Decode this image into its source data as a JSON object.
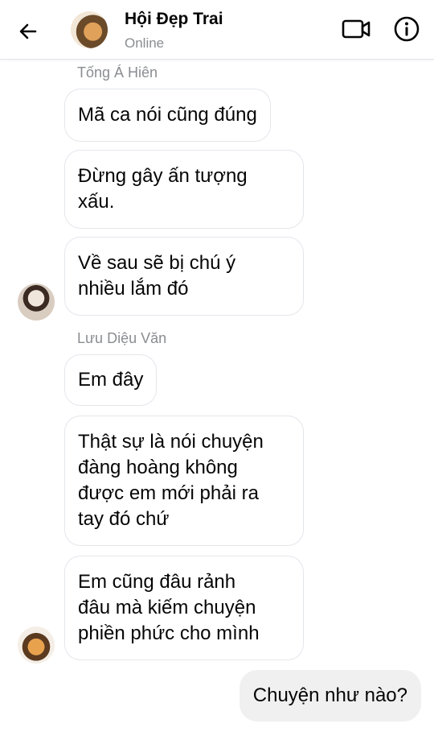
{
  "header": {
    "title": "Hội Đẹp Trai",
    "status": "Online",
    "icons": {
      "back": "back-arrow-icon",
      "video": "video-call-icon",
      "info": "info-icon"
    }
  },
  "messages": {
    "sender1": "Tống Á Hiên",
    "m1": "Mã ca nói cũng đúng",
    "m2_l1": "Đừng gây ấn tượng",
    "m2_l2": "xấu.",
    "m3_l1": "Về sau sẽ bị chú ý",
    "m3_l2": "nhiều lắm đó",
    "sender2": "Lưu Diệu Văn",
    "m4": "Em đây",
    "m5_l1": "Thật sự là nói chuyện",
    "m5_l2": "đàng hoàng không",
    "m5_l3": "được em mới phải ra",
    "m5_l4": "tay đó chứ",
    "m6_l1": "Em cũng đâu rảnh",
    "m6_l2": "đâu mà kiếm chuyện",
    "m6_l3": "phiền phức cho mình",
    "out1": "Chuyện như nào?"
  }
}
